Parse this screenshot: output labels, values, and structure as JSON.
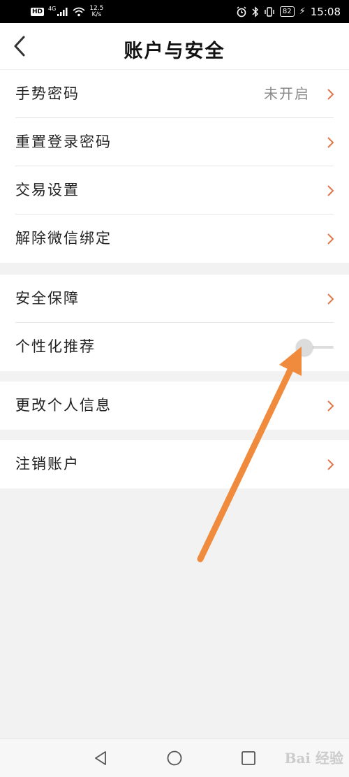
{
  "status_bar": {
    "hd": "HD",
    "network": "4G",
    "speed_value": "12.5",
    "speed_unit": "K/s",
    "battery": "82",
    "time": "15:08"
  },
  "header": {
    "title": "账户与安全"
  },
  "groups": [
    {
      "items": [
        {
          "label": "手势密码",
          "value": "未开启"
        },
        {
          "label": "重置登录密码"
        },
        {
          "label": "交易设置"
        },
        {
          "label": "解除微信绑定"
        }
      ]
    },
    {
      "items": [
        {
          "label": "安全保障"
        },
        {
          "label": "个性化推荐",
          "toggle": "off"
        }
      ]
    },
    {
      "items": [
        {
          "label": "更改个人信息"
        }
      ]
    },
    {
      "items": [
        {
          "label": "注销账户"
        }
      ]
    }
  ],
  "watermark": "Bai 经验",
  "colors": {
    "chevron": "#e0764a",
    "annotation_arrow": "#f08a3c",
    "toggle_off": "#dcdcdc"
  },
  "icons": [
    "back-arrow-icon",
    "chevron-right-icon",
    "nav-back-icon",
    "nav-home-icon",
    "nav-recents-icon"
  ]
}
